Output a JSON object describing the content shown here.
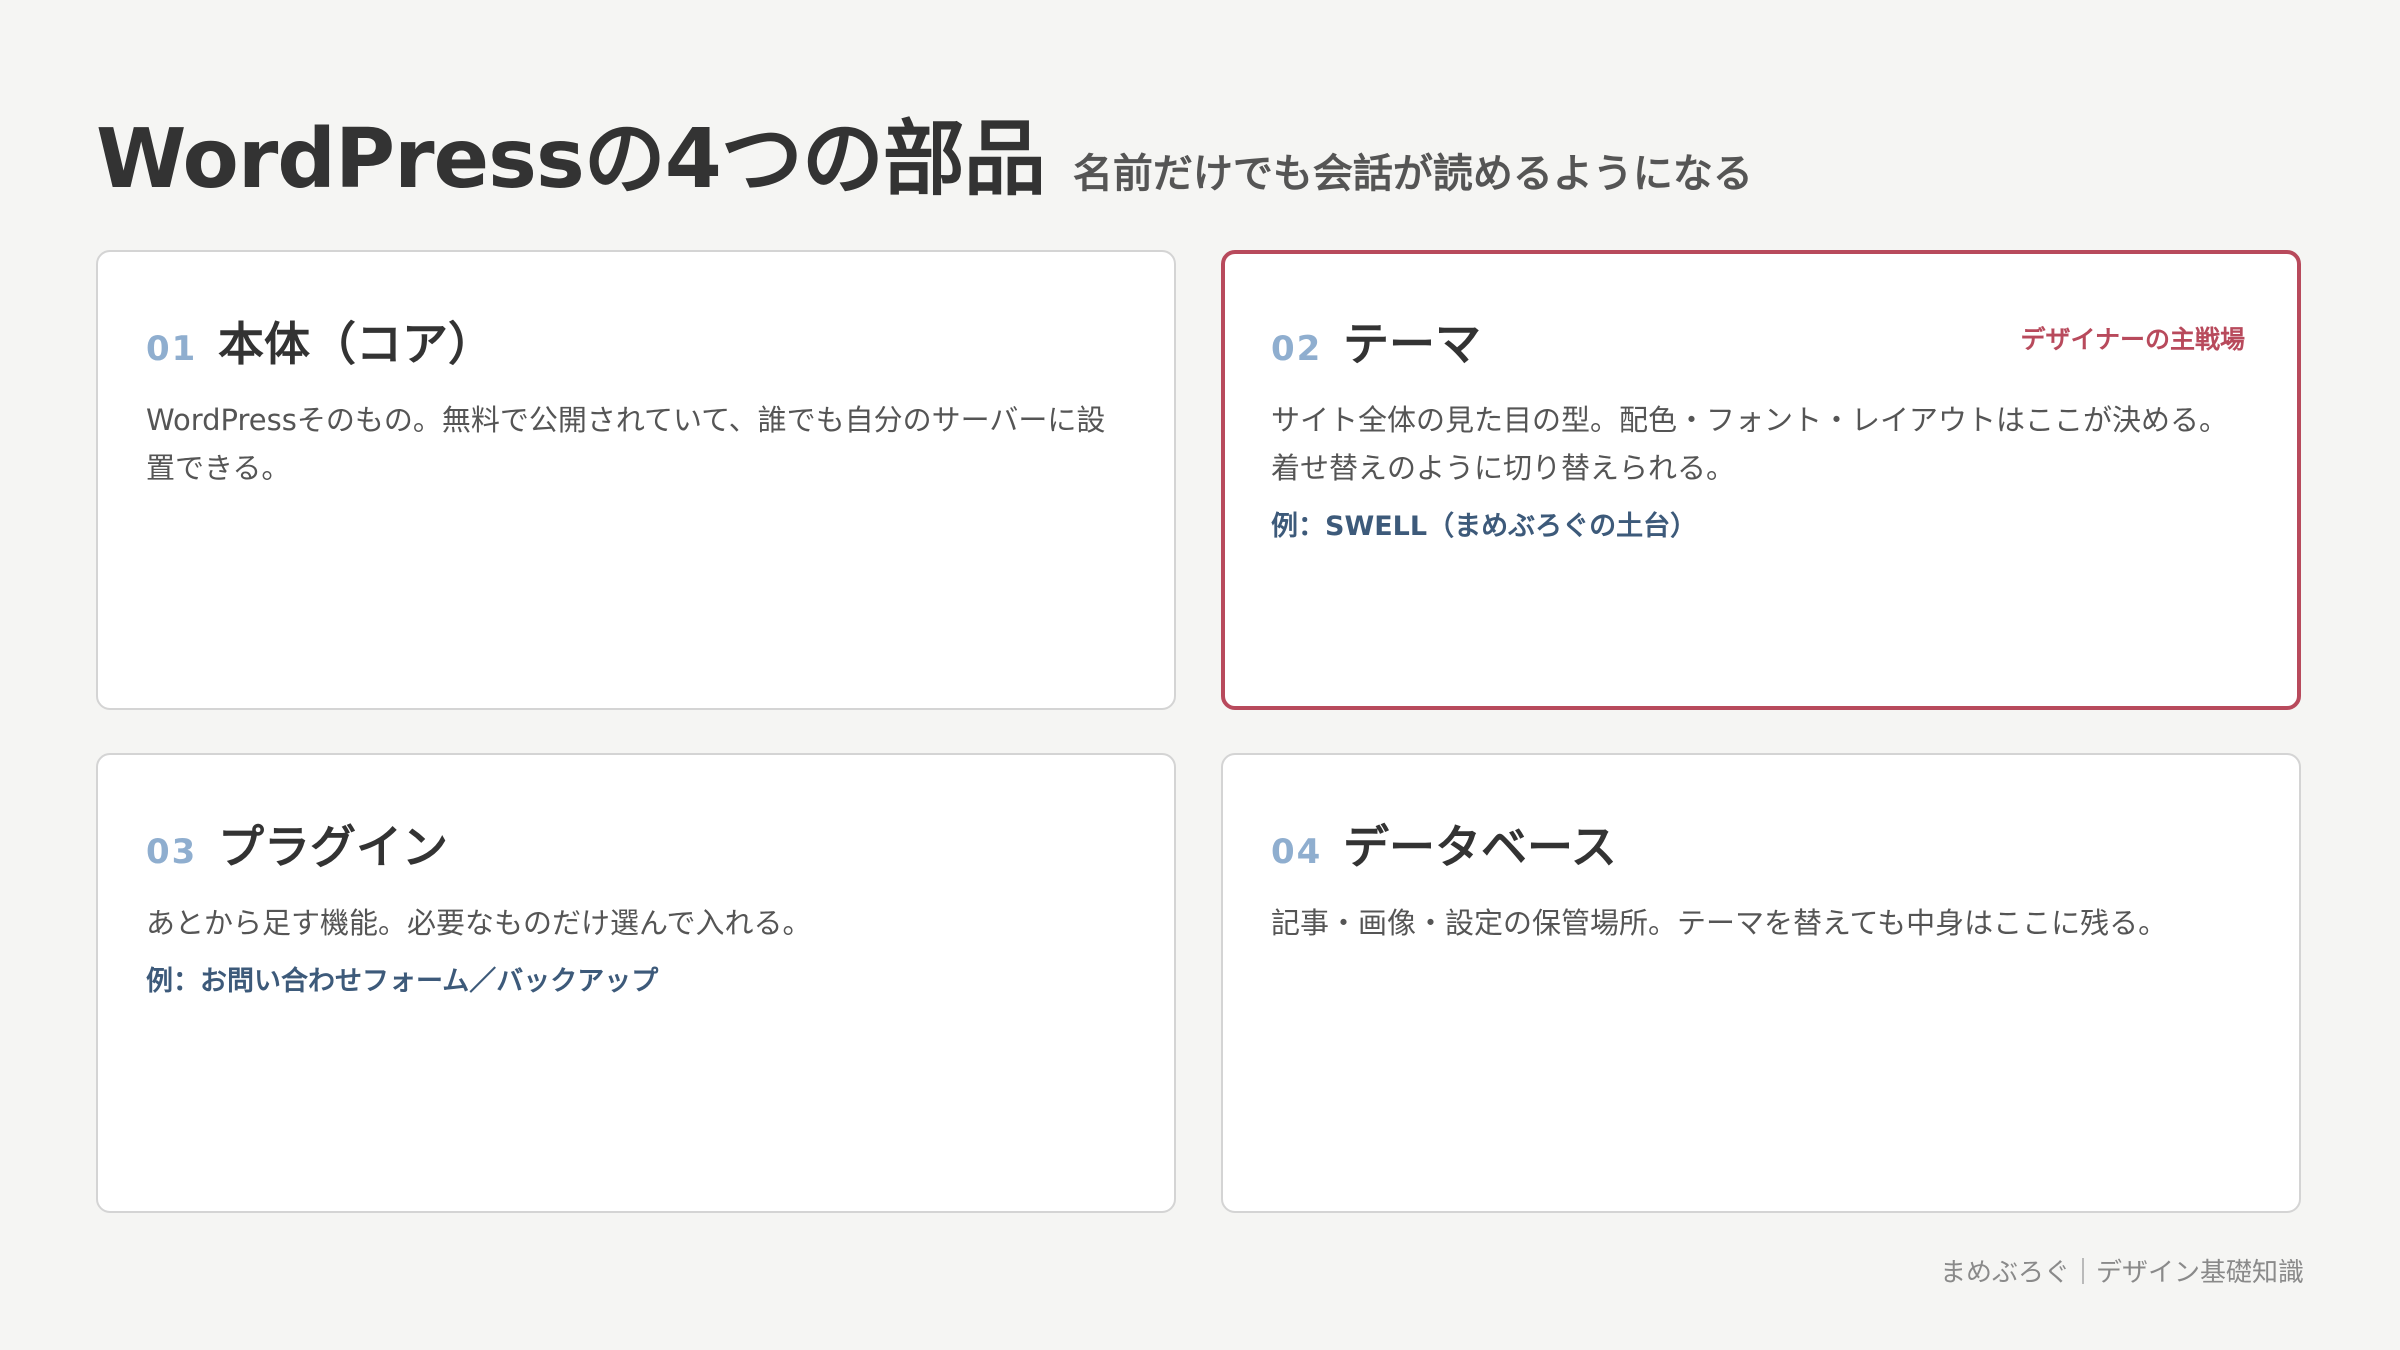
{
  "header": {
    "title": "WordPressの4つの部品",
    "subtitle": "名前だけでも会話が読めるようになる"
  },
  "cards": [
    {
      "number": "01",
      "title": "本体（コア）",
      "description": "WordPressそのもの。無料で公開されていて、誰でも自分のサーバーに設置できる。"
    },
    {
      "number": "02",
      "title": "テーマ",
      "tag": "デザイナーの主戦場",
      "description": "サイト全体の見た目の型。配色・フォント・レイアウトはここが決める。着せ替えのように切り替えられる。",
      "example": "例：SWELL（まめぶろぐの土台）",
      "accent_color": "#b84a5c"
    },
    {
      "number": "03",
      "title": "プラグイン",
      "description": "あとから足す機能。必要なものだけ選んで入れる。",
      "example": "例：お問い合わせフォーム／バックアップ"
    },
    {
      "number": "04",
      "title": "データベース",
      "description": "記事・画像・設定の保管場所。テーマを替えても中身はここに残る。"
    }
  ],
  "footer": {
    "credit": "まめぶろぐ｜デザイン基礎知識"
  }
}
